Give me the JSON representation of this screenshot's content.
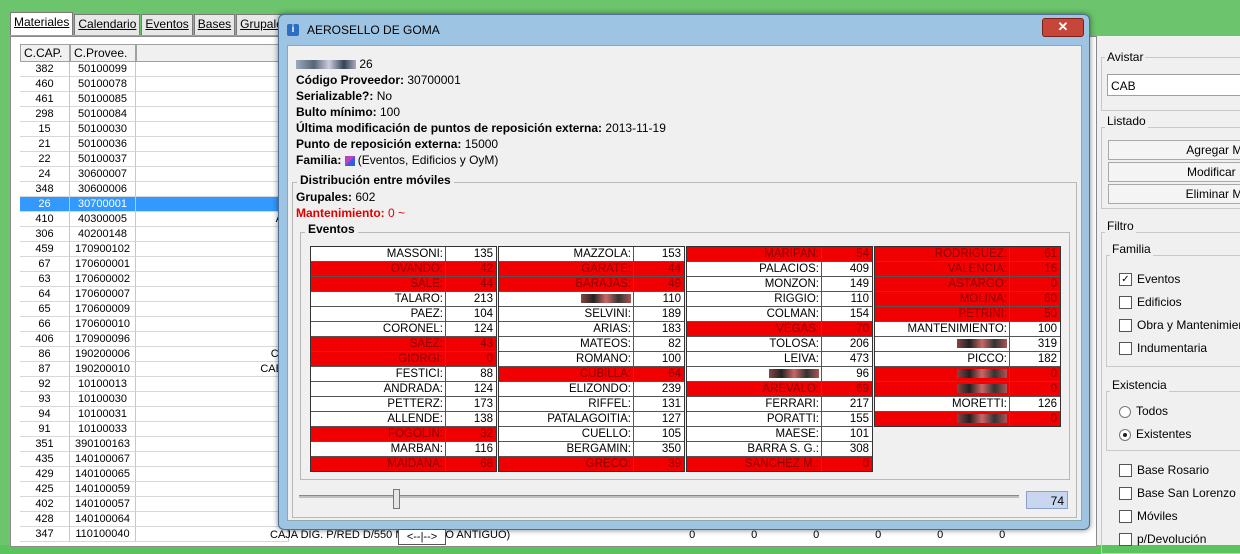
{
  "tabs": [
    "Materiales",
    "Calendario",
    "Eventos",
    "Bases",
    "Grupales"
  ],
  "grid": {
    "headers": [
      "C.CAP.",
      "C.Provee."
    ],
    "rows": [
      [
        "382",
        "50100099",
        ""
      ],
      [
        "460",
        "50100078",
        ""
      ],
      [
        "461",
        "50100085",
        ""
      ],
      [
        "298",
        "50100084",
        ""
      ],
      [
        "15",
        "50100030",
        ""
      ],
      [
        "21",
        "50100036",
        ""
      ],
      [
        "22",
        "50100037",
        ""
      ],
      [
        "24",
        "30600007",
        ""
      ],
      [
        "348",
        "30600006",
        ""
      ],
      [
        "26",
        "30700001",
        ""
      ],
      [
        "410",
        "40300005",
        "AI"
      ],
      [
        "306",
        "40200148",
        ""
      ],
      [
        "459",
        "170900102",
        ""
      ],
      [
        "67",
        "170600001",
        ""
      ],
      [
        "63",
        "170600002",
        ""
      ],
      [
        "64",
        "170600007",
        ""
      ],
      [
        "65",
        "170600009",
        ""
      ],
      [
        "66",
        "170600010",
        ""
      ],
      [
        "406",
        "170900096",
        ""
      ],
      [
        "86",
        "190200006",
        "CA"
      ],
      [
        "87",
        "190200010",
        "CABI"
      ],
      [
        "92",
        "10100013",
        ""
      ],
      [
        "93",
        "10100030",
        ""
      ],
      [
        "94",
        "10100031",
        ""
      ],
      [
        "91",
        "10100033",
        ""
      ],
      [
        "351",
        "390100163",
        ""
      ],
      [
        "435",
        "140100067",
        ""
      ],
      [
        "429",
        "140100065",
        ""
      ],
      [
        "425",
        "140100059",
        ""
      ],
      [
        "402",
        "140100057",
        "C"
      ],
      [
        "428",
        "140100064",
        ""
      ],
      [
        "347",
        "110100040",
        ""
      ]
    ],
    "selected_index": 9,
    "bottom_text": "CAJA DIG. P/RED D/550 M      C (DECO ANTIGUO)",
    "bottom_zeros": [
      "0",
      "0",
      "0",
      "0",
      "0",
      "0"
    ]
  },
  "right": {
    "avistar_label": "Avistar",
    "avistar_value": "CAB",
    "listado_label": "Listado",
    "buttons": [
      "Agregar Ma",
      "Modificar M",
      "Eliminar Ma"
    ],
    "filtro_label": "Filtro",
    "familia_label": "Familia",
    "familia_items": [
      {
        "label": "Eventos",
        "checked": true
      },
      {
        "label": "Edificios",
        "checked": false
      },
      {
        "label": "Obra y Mantenimier",
        "checked": false
      },
      {
        "label": "Indumentaria",
        "checked": false
      }
    ],
    "existencia_label": "Existencia",
    "existencia_items": [
      {
        "label": "Todos",
        "checked": false
      },
      {
        "label": "Existentes",
        "checked": true
      }
    ],
    "base_items": [
      {
        "label": "Base Rosario",
        "checked": false
      },
      {
        "label": "Base San Lorenzo",
        "checked": false
      },
      {
        "label": "Móviles",
        "checked": false
      },
      {
        "label": "p/Devolución",
        "checked": false
      }
    ]
  },
  "dialog": {
    "title": "AEROSELLO DE GOMA",
    "close_label": "✕",
    "first_line_value": "26",
    "fields": [
      {
        "label": "Código Proveedor:",
        "value": "30700001"
      },
      {
        "label": "Serializable?:",
        "value": "No"
      },
      {
        "label": "Bulto mínimo:",
        "value": "100"
      },
      {
        "label": "Última modificación de puntos de reposición externa:",
        "value": "2013-11-19"
      },
      {
        "label": "Punto de reposición externa:",
        "value": "15000"
      },
      {
        "label": "Familia:",
        "value": "(Eventos, Edificios y OyM)"
      }
    ],
    "distrib_label": "Distribución entre móviles",
    "grupales_label": "Grupales:",
    "grupales_value": "602",
    "mant_label": "Mantenimiento:",
    "mant_value": "0 ~",
    "eventos_label": "Eventos",
    "columns": [
      [
        [
          "MASSONI:",
          "135",
          0
        ],
        [
          "OVANDO:",
          "42",
          1
        ],
        [
          "SALE:",
          "44",
          1
        ],
        [
          "TALARO:",
          "213",
          0
        ],
        [
          "PAEZ:",
          "104",
          0
        ],
        [
          "CORONEL:",
          "124",
          0
        ],
        [
          "SAEZ:",
          "43",
          1
        ],
        [
          "GIORGI:",
          "0",
          1
        ],
        [
          "FESTICI:",
          "88",
          0
        ],
        [
          "ANDRADA:",
          "124",
          0
        ],
        [
          "PETTERZ:",
          "173",
          0
        ],
        [
          "ALLENDE:",
          "138",
          0
        ],
        [
          "FOGOLIN:",
          "32",
          1
        ],
        [
          "MARBAN:",
          "116",
          0
        ],
        [
          "MAIDANA:",
          "68",
          1
        ]
      ],
      [
        [
          "MAZZOLA:",
          "153",
          0
        ],
        [
          "GARATE:",
          "44",
          1
        ],
        [
          "BARAJAS:",
          "49",
          1
        ],
        [
          "",
          "110",
          0
        ],
        [
          "SELVINI:",
          "189",
          0
        ],
        [
          "ARIAS:",
          "183",
          0
        ],
        [
          "MATEOS:",
          "82",
          0
        ],
        [
          "ROMANO:",
          "100",
          0
        ],
        [
          "CUBILLA:",
          "64",
          1
        ],
        [
          "ELIZONDO:",
          "239",
          0
        ],
        [
          "RIFFEL:",
          "131",
          0
        ],
        [
          "PATALAGOITIA:",
          "127",
          0
        ],
        [
          "CUELLO:",
          "105",
          0
        ],
        [
          "BERGAMIN:",
          "350",
          0
        ],
        [
          "GRECO:",
          "39",
          1
        ]
      ],
      [
        [
          "MARIPAN:",
          "54",
          1
        ],
        [
          "PALACIOS:",
          "409",
          0
        ],
        [
          "MONZON:",
          "149",
          0
        ],
        [
          "RIGGIO:",
          "110",
          0
        ],
        [
          "COLMAN:",
          "154",
          0
        ],
        [
          "VEGAS:",
          "70",
          1
        ],
        [
          "TOLOSA:",
          "206",
          0
        ],
        [
          "LEIVA:",
          "473",
          0
        ],
        [
          "",
          "96",
          0
        ],
        [
          "AREVALO:",
          "69",
          1
        ],
        [
          "FERRARI:",
          "217",
          0
        ],
        [
          "PORATTI:",
          "155",
          0
        ],
        [
          "MAESE:",
          "101",
          0
        ],
        [
          "BARRA S. G.:",
          "308",
          0
        ],
        [
          "SANCHEZ M.:",
          "0",
          1
        ]
      ],
      [
        [
          "RODRIGUEZ:",
          "61",
          1
        ],
        [
          "VALENCIA:",
          "16",
          1
        ],
        [
          "ASTARGO:",
          "0",
          1
        ],
        [
          "MOLINA:",
          "60",
          1
        ],
        [
          "PETRINI:",
          "50",
          1
        ],
        [
          "MANTENIMIENTO:",
          "100",
          0
        ],
        [
          "",
          "319",
          0
        ],
        [
          "PICCO:",
          "182",
          0
        ],
        [
          "",
          "0",
          1
        ],
        [
          "",
          "0",
          1
        ],
        [
          "MORETTI:",
          "126",
          0
        ],
        [
          "",
          "0",
          1
        ]
      ]
    ],
    "slider_value": "74",
    "tooltip": "<--|-->",
    "colors": {
      "alert": "#f00000",
      "selected": "#3399ff"
    }
  }
}
